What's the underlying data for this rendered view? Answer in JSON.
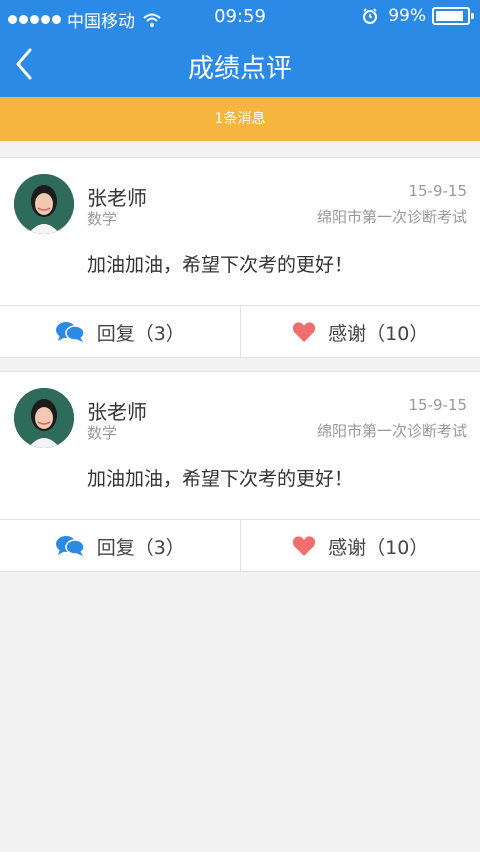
{
  "status_bar": {
    "carrier": "中国移动",
    "time": "09:59",
    "battery": "99%",
    "battery_level": 0.99
  },
  "nav": {
    "title": "成绩点评"
  },
  "notice": "1条消息",
  "colors": {
    "header": "#2a8ae6",
    "notice": "#f5b53f",
    "reply_icon": "#2a8ae6",
    "heart_icon": "#f06e6e"
  },
  "cards": [
    {
      "name": "张老师",
      "subject": "数学",
      "date": "15-9-15",
      "exam": "绵阳市第一次诊断考试",
      "comment": "加油加油，希望下次考的更好！",
      "reply": "回复（3）",
      "thanks": "感谢（10）"
    },
    {
      "name": "张老师",
      "subject": "数学",
      "date": "15-9-15",
      "exam": "绵阳市第一次诊断考试",
      "comment": "加油加油，希望下次考的更好！",
      "reply": "回复（3）",
      "thanks": "感谢（10）"
    }
  ]
}
